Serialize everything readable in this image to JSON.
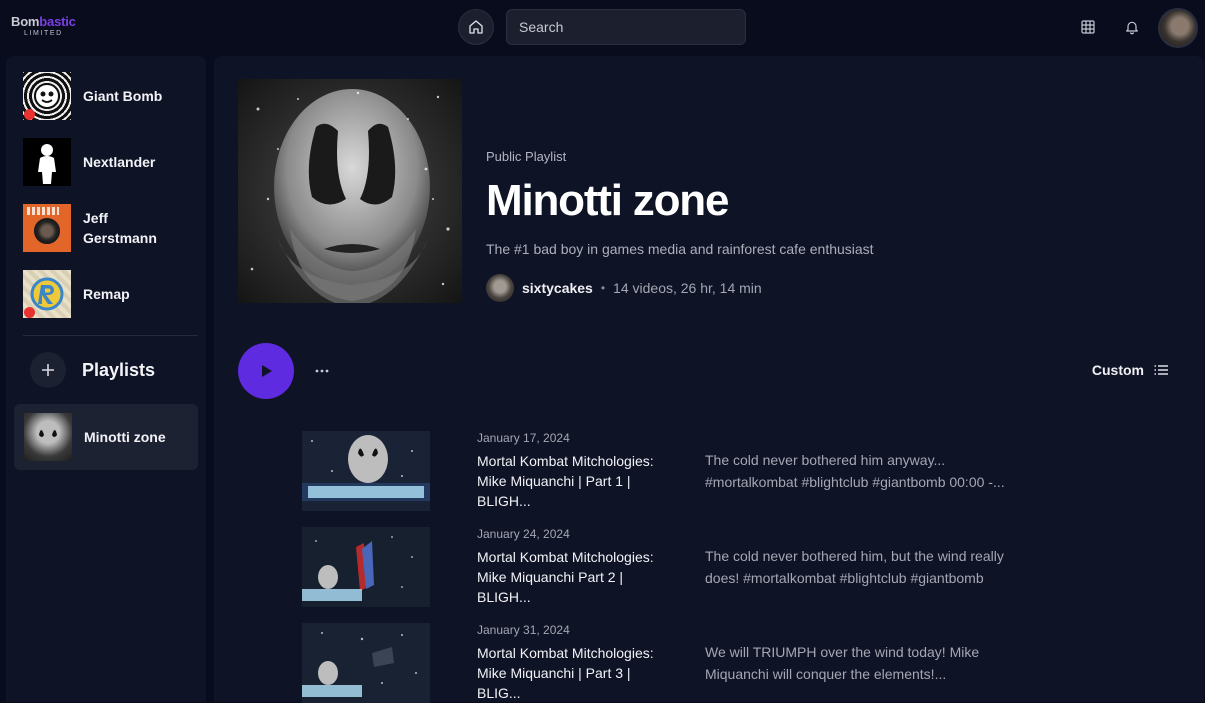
{
  "brand": {
    "name_a": "Bom",
    "name_b": "bastic",
    "sub": "LIMITED"
  },
  "header": {
    "search_placeholder": "Search"
  },
  "colors": {
    "accent": "#5f2be0",
    "live": "#e8322f",
    "background": "#080c1c",
    "panel": "#0e1326"
  },
  "sidebar": {
    "subscriptions": [
      {
        "label": "Giant Bomb",
        "live": true
      },
      {
        "label": "Nextlander",
        "live": false
      },
      {
        "label": "Jeff Gerstmann",
        "live": false
      },
      {
        "label": "Remap",
        "live": true
      }
    ],
    "playlists_title": "Playlists",
    "playlists": [
      {
        "label": "Minotti zone"
      }
    ]
  },
  "playlist": {
    "type": "Public Playlist",
    "name": "Minotti zone",
    "description": "The #1 bad boy in games media and rainforest cafe enthusiast",
    "owner": "sixtycakes",
    "separator": "•",
    "stats": "14 videos, 26 hr, 14 min",
    "sort_label": "Custom"
  },
  "videos": [
    {
      "date": "January 17, 2024",
      "title": "Mortal Kombat Mitchologies: Mike Miquanchi | Part 1 | BLIGH...",
      "description": "The cold never bothered him anyway... #mortalkombat #blightclub #giantbomb 00:00 -..."
    },
    {
      "date": "January 24, 2024",
      "title": "Mortal Kombat Mitchologies: Mike Miquanchi Part 2 | BLIGH...",
      "description": "The cold never bothered him, but the wind really does! #mortalkombat #blightclub #giantbomb"
    },
    {
      "date": "January 31, 2024",
      "title": "Mortal Kombat Mitchologies: Mike Miquanchi | Part 3 | BLIG...",
      "description": "We will TRIUMPH over the wind today! Mike Miquanchi will conquer the elements!..."
    }
  ]
}
